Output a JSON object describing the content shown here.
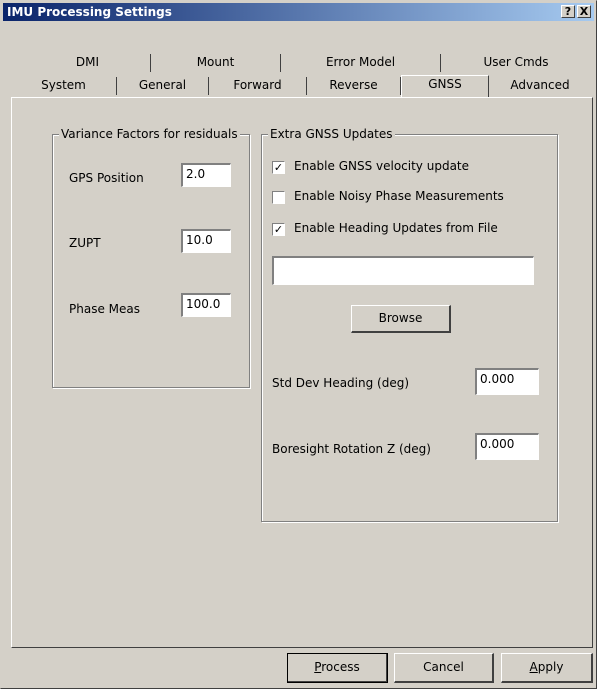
{
  "window": {
    "title": "IMU Processing Settings",
    "help_label": "?",
    "close_label": "X"
  },
  "tabs_row1": [
    {
      "label": "DMI"
    },
    {
      "label": "Mount"
    },
    {
      "label": "Error Model"
    },
    {
      "label": "User Cmds"
    }
  ],
  "tabs_row2": [
    {
      "label": "System"
    },
    {
      "label": "General"
    },
    {
      "label": "Forward"
    },
    {
      "label": "Reverse"
    },
    {
      "label": "GNSS"
    },
    {
      "label": "Advanced"
    }
  ],
  "active_tab": "GNSS",
  "variance": {
    "title": "Variance Factors for residuals",
    "gps_position": {
      "label": "GPS Position",
      "value": "2.0"
    },
    "zupt": {
      "label": "ZUPT",
      "value": "10.0"
    },
    "phase_meas": {
      "label": "Phase Meas",
      "value": "100.0"
    }
  },
  "extra": {
    "title": "Extra GNSS  Updates",
    "velocity": {
      "label": "Enable GNSS velocity update",
      "checked": true,
      "mark": "✓"
    },
    "noisy_phase": {
      "label": "Enable Noisy Phase Measurements",
      "checked": false,
      "mark": ""
    },
    "heading_file": {
      "label": "Enable Heading Updates from File",
      "checked": true,
      "mark": "✓"
    },
    "file_path": "",
    "browse_label": "Browse",
    "std_dev_heading": {
      "label": "Std Dev Heading (deg)",
      "value": "0.000"
    },
    "boresight_z": {
      "label": "Boresight Rotation Z (deg)",
      "value": "0.000"
    }
  },
  "buttons": {
    "process": {
      "hotkey": "P",
      "rest": "rocess"
    },
    "cancel": {
      "label": "Cancel"
    },
    "apply": {
      "hotkey": "A",
      "rest": "pply"
    }
  }
}
